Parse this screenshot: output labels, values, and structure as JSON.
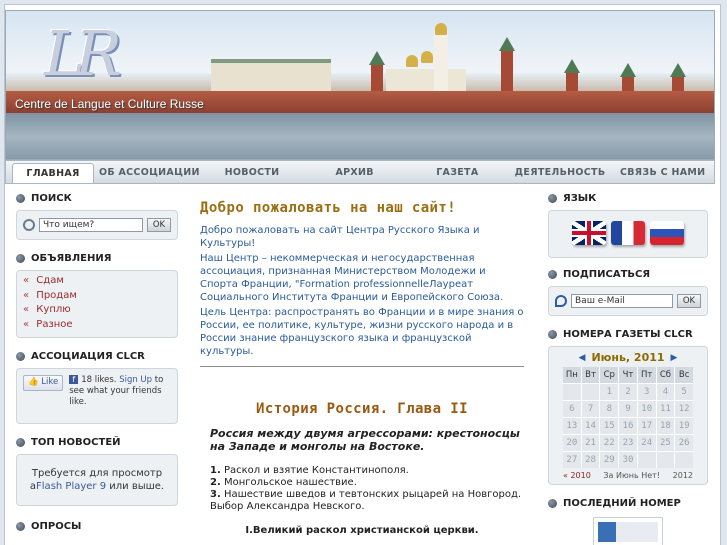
{
  "header": {
    "logo": "LR",
    "subtitle": "Centre de Langue et Culture Russe"
  },
  "nav": {
    "items": [
      "ГЛАВНАЯ",
      "ОБ АССОЦИАЦИИ",
      "НОВОСТИ",
      "АРХИВ",
      "ГАЗЕТА",
      "ДЕЯТЕЛЬНОСТЬ",
      "СВЯЗЬ С НАМИ"
    ],
    "active": "ГЛАВНАЯ"
  },
  "left": {
    "search": {
      "title": "ПОИСК",
      "placeholder": "Что ищем?",
      "button": "OK"
    },
    "ads": {
      "title": "ОБЪЯВЛЕНИЯ",
      "items": [
        "Сдам",
        "Продам",
        "Куплю",
        "Разное"
      ]
    },
    "association": {
      "title": "АССОЦИАЦИЯ CLCR",
      "like_label": "Like",
      "count_text": "18 likes.",
      "signup": "Sign Up",
      "rest": "to see what your friends like."
    },
    "top_news": {
      "title": "ТОП НОВОСТЕЙ",
      "text1": "Требуется для просмотр а",
      "link": "Flash Player 9",
      "text2": " или выше."
    },
    "polls": {
      "title": "ОПРОСЫ"
    }
  },
  "main": {
    "welcome_title": "Добро пожаловать на наш сайт!",
    "p1": "Добро пожаловать на сайт Центра Русского Языка и Культуры!",
    "p2": "Наш Центр      – некоммерческая и негосударственная ассоциация, признанная Министерством Молодежи и Спорта Франции,    \"Formation  professionnelleЛауреат Социального Института Франции и Европейского Союза.",
    "p3": "Цель Центра: распространять во Франции и в мире знания о России, ее политике, культуре, жизни русского народа и в России знание французского языка и французской культуры.",
    "history_title": "История Россия. Глава II",
    "subtitle": "Россия между двумя агрессорами: крестоносцы на Западе и монголы на Востоке.",
    "list": [
      {
        "n": "1.",
        "t": " Раскол и взятие Константинополя."
      },
      {
        "n": "2.",
        "t": " Монгольское нашествие."
      },
      {
        "n": "3.",
        "t": " Нашествие шведов и тевтонских рыцарей на Новгород. Выбор Александра Невского."
      }
    ],
    "section": "I.Великий раскол христианской церкви."
  },
  "right": {
    "language": {
      "title": "ЯЗЫК"
    },
    "subscribe": {
      "title": "ПОДПИСАТЬСЯ",
      "placeholder": "Ваш e-Mail",
      "button": "OK"
    },
    "issues": {
      "title": "НОМЕРА ГАЗЕТЫ CLCR",
      "month": "Июнь, 2011",
      "weekdays": [
        "Пн",
        "Вт",
        "Ср",
        "Чт",
        "Пт",
        "Сб",
        "Вс"
      ],
      "days": [
        "",
        "",
        "1",
        "2",
        "3",
        "4",
        "5",
        "6",
        "7",
        "8",
        "9",
        "10",
        "11",
        "12",
        "13",
        "14",
        "15",
        "16",
        "17",
        "18",
        "19",
        "20",
        "21",
        "22",
        "23",
        "24",
        "25",
        "26",
        "27",
        "28",
        "29",
        "30",
        "",
        "",
        ""
      ],
      "prev_year": "2010",
      "footer_text": "За Июнь Нет!",
      "next_year": "2012"
    },
    "last_issue": {
      "title": "ПОСЛЕДНИЙ НОМЕР"
    }
  }
}
